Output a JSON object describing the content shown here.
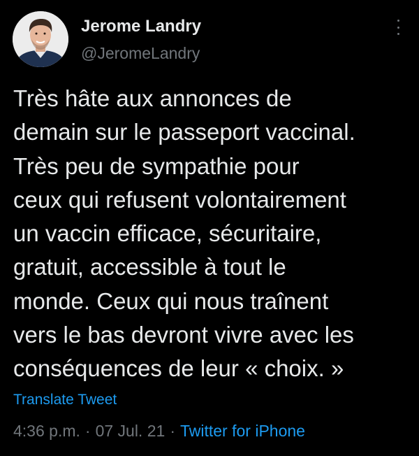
{
  "author": {
    "display_name": "Jerome Landry",
    "handle": "@JeromeLandry",
    "avatar_icon": "profile-photo"
  },
  "tweet": {
    "text": "Très hâte aux annonces de\ndemain sur le passeport vaccinal.\nTrès peu de sympathie pour\nceux qui refusent volontairement\nun vaccin efficace, sécuritaire,\ngratuit, accessible à tout le\nmonde. Ceux qui nous traînent\nvers le bas devront vivre avec les\nconséquences de leur « choix. »",
    "translate_label": "Translate Tweet"
  },
  "meta": {
    "time": "4:36 p.m.",
    "separator": "·",
    "date": "07 Jul. 21",
    "source": "Twitter for iPhone"
  },
  "icons": {
    "more": "more-vertical-icon"
  },
  "colors": {
    "background": "#000000",
    "text": "#e7e9ea",
    "muted": "#71767b",
    "link": "#1d9bf0"
  }
}
